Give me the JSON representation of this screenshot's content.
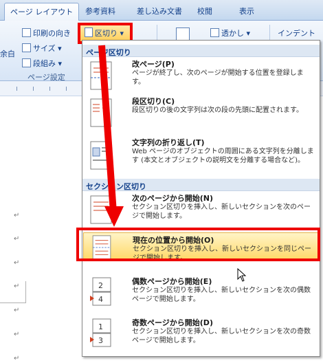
{
  "tabs": [
    {
      "label": "ページ レイアウト",
      "active": true
    },
    {
      "label": "参考資料"
    },
    {
      "label": "差し込み文書"
    },
    {
      "label": "校閲"
    },
    {
      "label": "表示"
    }
  ],
  "ribbon": {
    "print_direction": "印刷の向き",
    "size": "サイズ",
    "columns": "段組み",
    "margin_partial": "余白",
    "group_label": "ページ設定",
    "break_button": "区切り",
    "watermark": "透かし",
    "indent": "インデント"
  },
  "menu": {
    "page_breaks_header": "ページ区切り",
    "section_breaks_header": "セクション区切り",
    "items": [
      {
        "title": "改ページ(P)",
        "desc": "ページが終了し、次のページが開始する位置を登録します。"
      },
      {
        "title": "段区切り(C)",
        "desc": "段区切りの後の文字列は次の段の先頭に配置されます。"
      },
      {
        "title": "文字列の折り返し(T)",
        "desc": "Web ページのオブジェクトの周囲にある文字列を分離します (本文とオブジェクトの説明文を分離する場合など)。"
      },
      {
        "title": "次のページから開始(N)",
        "desc": "セクション区切りを挿入し、新しいセクションを次のページで開始します。"
      },
      {
        "title": "現在の位置から開始(O)",
        "desc": "セクション区切りを挿入し、新しいセクションを同じページで開始します。",
        "highlighted": true
      },
      {
        "title": "偶数ページから開始(E)",
        "desc": "セクション区切りを挿入し、新しいセクションを次の偶数ページで開始します。"
      },
      {
        "title": "奇数ページから開始(D)",
        "desc": "セクション区切りを挿入し、新しいセクションを次の奇数ページで開始します。"
      }
    ]
  },
  "colors": {
    "highlight_red": "#ee0000",
    "hover": "#ffd865",
    "ribbon": "#d7e5f6"
  }
}
